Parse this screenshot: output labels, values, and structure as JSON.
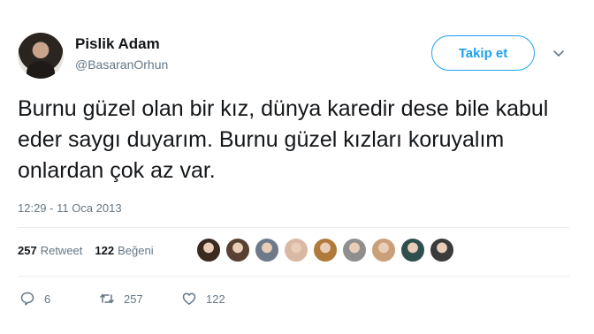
{
  "user": {
    "name": "Pislik Adam",
    "handle": "@BasaranOrhun"
  },
  "follow_button": {
    "label": "Takip et"
  },
  "tweet": {
    "text": "Burnu güzel olan bir kız, dünya karedir dese bile kabul eder saygı duyarım. Burnu güzel kızları koruyalım onlardan çok az var.",
    "timestamp": "12:29 - 11 Oca 2013"
  },
  "stats": {
    "retweet_count": "257",
    "retweet_label": "Retweet",
    "like_count": "122",
    "like_label": "Beğeni"
  },
  "likers": [
    {
      "color": "#3a2a20"
    },
    {
      "color": "#5a4032"
    },
    {
      "color": "#6d7a8a"
    },
    {
      "color": "#d9b9a3"
    },
    {
      "color": "#b07a3a"
    },
    {
      "color": "#8f8f8f"
    },
    {
      "color": "#caa07a"
    },
    {
      "color": "#2f4f4f"
    },
    {
      "color": "#3b3b3b"
    }
  ],
  "actions": {
    "reply_count": "6",
    "retweet_count": "257",
    "like_count": "122"
  },
  "colors": {
    "accent": "#1da1f2",
    "muted": "#657786",
    "text": "#14171a",
    "divider": "#e6ecf0"
  }
}
